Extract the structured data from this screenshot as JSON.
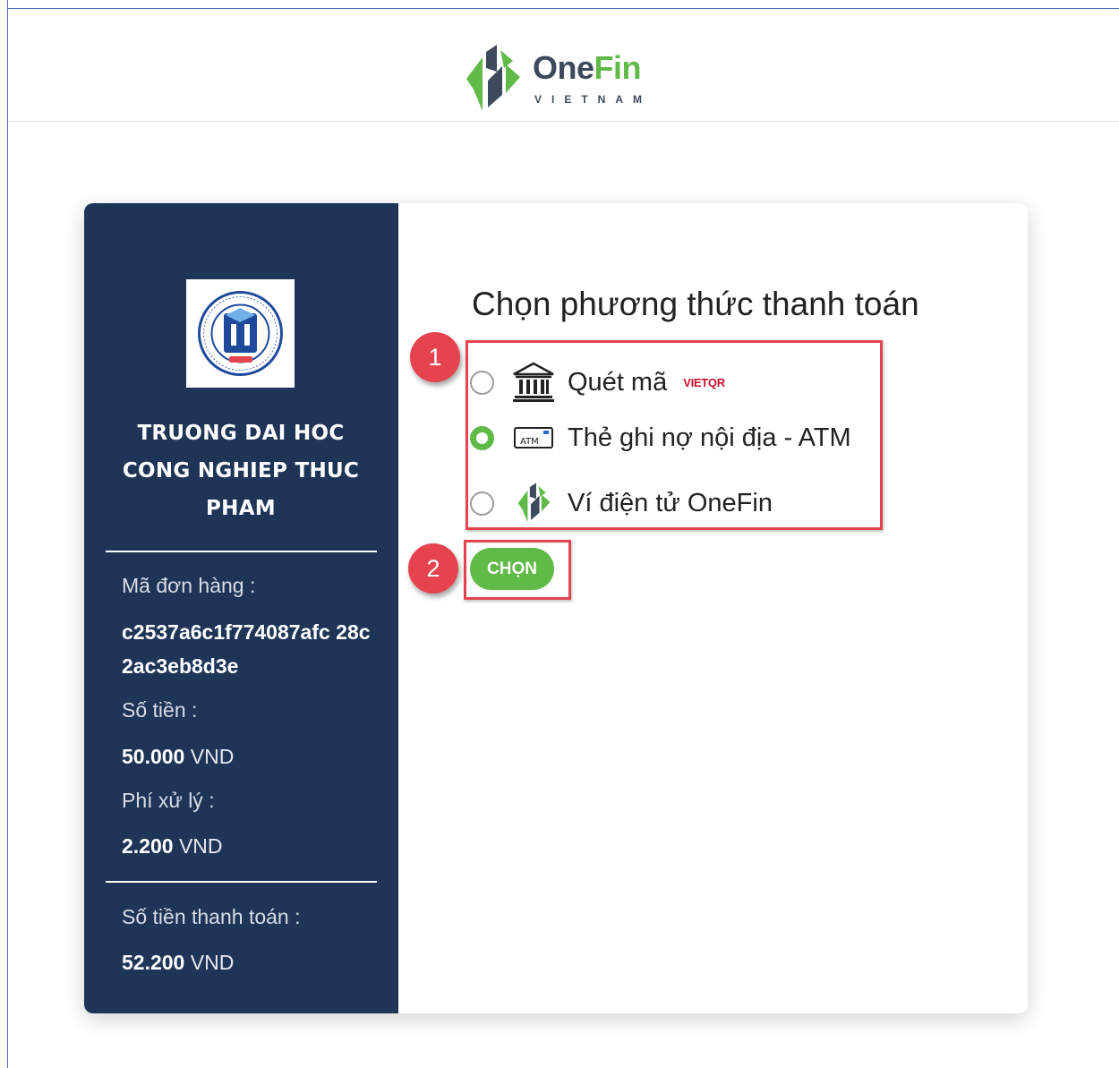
{
  "header": {
    "brand_one": "One",
    "brand_fin": "Fin",
    "brand_sub": "VIETNAM",
    "logo_icon": "onefin-logo-icon"
  },
  "merchant": {
    "name": "TRUONG DAI HOC CONG NGHIEP THUC PHAM",
    "logo_icon": "hufi-university-seal"
  },
  "order": {
    "order_id_label": "Mã đơn hàng :",
    "order_id_value": "c2537a6c1f774087afc 28c2ac3eb8d3e",
    "amount_label": "Số tiền :",
    "amount_value": "50.000",
    "amount_unit": "VND",
    "fee_label": "Phí xử lý :",
    "fee_value": "2.200",
    "fee_unit": "VND",
    "total_label": "Số tiền thanh toán :",
    "total_value": "52.200",
    "total_unit": "VND"
  },
  "payment": {
    "title": "Chọn phương thức thanh toán",
    "options": [
      {
        "label": "Quét mã",
        "icon": "bank-icon",
        "tag": "VIETQR",
        "selected": false
      },
      {
        "label": "Thẻ ghi nợ nội địa - ATM",
        "icon": "atm-card-icon",
        "selected": true
      },
      {
        "label": "Ví điện tử OneFin",
        "icon": "onefin-wallet-icon",
        "selected": false
      }
    ],
    "choose_button": "CHỌN"
  },
  "annotations": {
    "step1": "1",
    "step2": "2",
    "highlight_color": "#e5444f"
  },
  "colors": {
    "sidebar_bg": "#1e3558",
    "accent_green": "#5fba47",
    "brand_dark": "#3d4a5c"
  }
}
